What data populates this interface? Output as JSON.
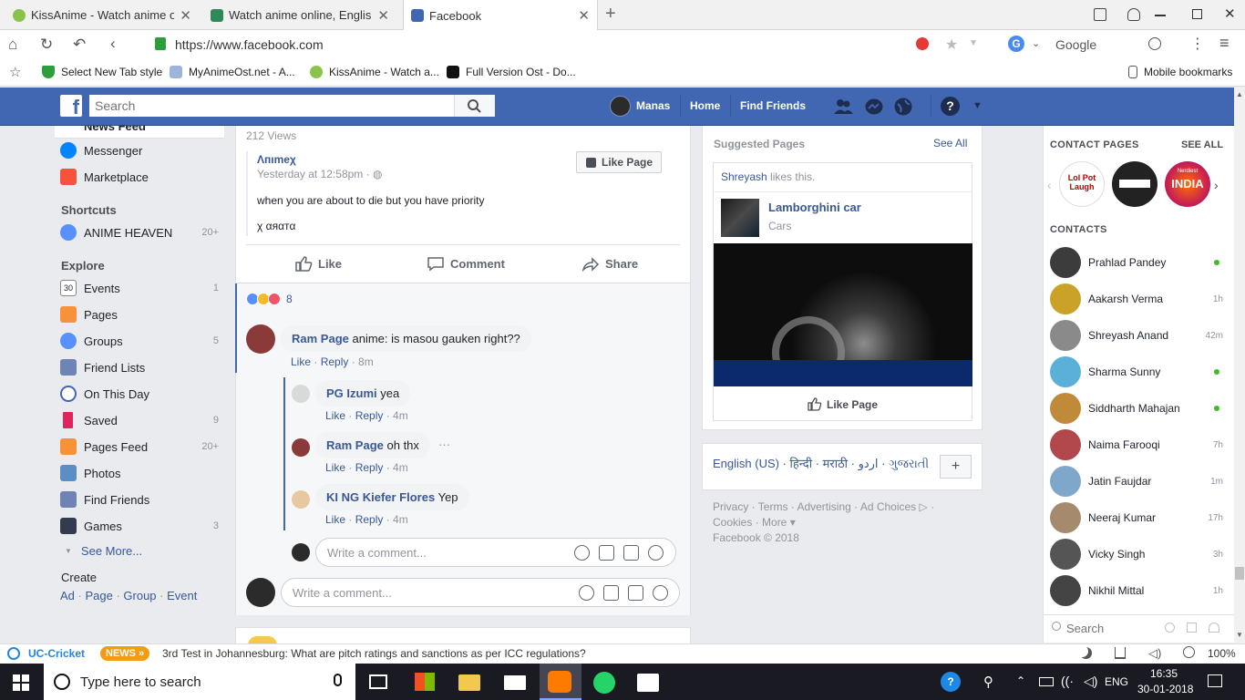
{
  "browser": {
    "tabs": [
      {
        "title": "KissAnime - Watch anime onli",
        "favicon_color": "#8bc34a"
      },
      {
        "title": "Watch anime online, English a",
        "favicon_color": "#2e8b57"
      },
      {
        "title": "Facebook",
        "favicon_color": "#4267b2"
      }
    ],
    "new_tab": "+",
    "url": "https://www.facebook.com",
    "search_engine": "Google",
    "bookmarks": [
      {
        "label": "Select New Tab style",
        "icon": "shield-icon"
      },
      {
        "label": "MyAnimeOst.net - A...",
        "icon": "myanime-icon"
      },
      {
        "label": "KissAnime - Watch a...",
        "icon": "kissanime-icon"
      },
      {
        "label": "Full Version Ost - Do...",
        "icon": "ost-icon"
      }
    ],
    "mobile_bookmarks": "Mobile bookmarks"
  },
  "fb_header": {
    "search_placeholder": "Search",
    "user": "Manas",
    "home": "Home",
    "find_friends": "Find Friends"
  },
  "left_nav": {
    "top_items": [
      {
        "label": "News Feed",
        "color": "#4267b2"
      },
      {
        "label": "Messenger",
        "color": "#0084ff"
      },
      {
        "label": "Marketplace",
        "color": "#f5533d"
      }
    ],
    "shortcuts_heading": "Shortcuts",
    "shortcuts": [
      {
        "label": "ANIME HEAVEN",
        "count": "20+",
        "color": "#5890ff"
      }
    ],
    "explore_heading": "Explore",
    "explore": [
      {
        "label": "Events",
        "count": "1",
        "color": "#e9ebee",
        "icon": "calendar-icon"
      },
      {
        "label": "Pages",
        "count": "",
        "color": "#f7923b",
        "icon": "flag-icon"
      },
      {
        "label": "Groups",
        "count": "5",
        "color": "#5890ff",
        "icon": "groups-icon"
      },
      {
        "label": "Friend Lists",
        "count": "",
        "color": "#6d84b4",
        "icon": "friendlist-icon"
      },
      {
        "label": "On This Day",
        "count": "",
        "color": "#4267b2",
        "icon": "clock-icon"
      },
      {
        "label": "Saved",
        "count": "9",
        "color": "#e0245e",
        "icon": "bookmark-icon"
      },
      {
        "label": "Pages Feed",
        "count": "20+",
        "color": "#f7923b",
        "icon": "pagesfeed-icon"
      },
      {
        "label": "Photos",
        "count": "",
        "color": "#5b8ec4",
        "icon": "photos-icon"
      },
      {
        "label": "Find Friends",
        "count": "",
        "color": "#6d84b4",
        "icon": "findfriends-icon"
      },
      {
        "label": "Games",
        "count": "3",
        "color": "#333c4e",
        "icon": "games-icon"
      }
    ],
    "see_more": "See More...",
    "create_heading": "Create",
    "create_links": [
      "Ad",
      "Page",
      "Group",
      "Event"
    ]
  },
  "post": {
    "views": "212 Views",
    "shared_author": "Λпımeχ",
    "shared_time": "Yesterday at 12:58pm",
    "like_page": "Like Page",
    "text1": "when you are about to die but you have priority",
    "text2": "χ αяαтα",
    "actions": {
      "like": "Like",
      "comment": "Comment",
      "share": "Share"
    },
    "reaction_count": "8",
    "comments": [
      {
        "name": "Ram Page",
        "text": "anime: is masou gauken right??",
        "like": "Like",
        "reply": "Reply",
        "time": "8m",
        "avatar_color": "#8b3a3a"
      },
      {
        "name": "PG Izumi",
        "text": "yea",
        "like": "Like",
        "reply": "Reply",
        "time": "4m",
        "avatar_color": "#d9d9d9"
      },
      {
        "name": "Ram Page",
        "text": "oh thx",
        "like": "Like",
        "reply": "Reply",
        "time": "4m",
        "avatar_color": "#8b3a3a"
      },
      {
        "name": "KI NG Kiefer Flores",
        "text": "Yep",
        "like": "Like",
        "reply": "Reply",
        "time": "4m",
        "avatar_color": "#e8c8a0"
      }
    ],
    "more_dots": "···",
    "reply_placeholder": "Write a comment...",
    "comment_placeholder": "Write a comment..."
  },
  "suggested": {
    "title": "Suggested Pages",
    "see_all": "See All",
    "friend_like_name": "Shreyash",
    "friend_like_text": "likes this.",
    "page_name": "Lamborghini car",
    "page_category": "Cars",
    "like_page": "Like Page"
  },
  "footer": {
    "languages": "English (US) · हिन्दी · मराठी · اردو · ગુજરાતી",
    "add_lang": "+",
    "links1": "Privacy · Terms · Advertising · Ad Choices ▷ ·",
    "links2": "Cookies · More ▾",
    "copyright": "Facebook © 2018"
  },
  "chat": {
    "contact_pages": "CONTACT PAGES",
    "see_all": "SEE ALL",
    "pages": [
      {
        "label": "Lol Pot Laugh",
        "color": "#ffffff"
      },
      {
        "label": "",
        "color": "#222222"
      },
      {
        "label": "INDIA",
        "color": "#c2185b"
      }
    ],
    "pages_caption_top": "Nerdiest",
    "contacts_heading": "CONTACTS",
    "contacts": [
      {
        "name": "Prahlad Pandey",
        "status": "online",
        "color": "#3c3c3c"
      },
      {
        "name": "Aakarsh Verma",
        "status": "1h",
        "color": "#c9a227"
      },
      {
        "name": "Shreyash Anand",
        "status": "42m",
        "color": "#8a8a8a"
      },
      {
        "name": "Sharma Sunny",
        "status": "online",
        "color": "#5ab0d8"
      },
      {
        "name": "Siddharth Mahajan",
        "status": "online",
        "color": "#c08a3a"
      },
      {
        "name": "Naima Farooqi",
        "status": "7h",
        "color": "#b2474c"
      },
      {
        "name": "Jatin Faujdar",
        "status": "1m",
        "color": "#7fa7c9"
      },
      {
        "name": "Neeraj Kumar",
        "status": "17h",
        "color": "#a68a6d"
      },
      {
        "name": "Vicky Singh",
        "status": "3h",
        "color": "#555555"
      },
      {
        "name": "Nikhil Mittal",
        "status": "1h",
        "color": "#444444"
      }
    ],
    "search_placeholder": "Search"
  },
  "news": {
    "source": "UC-Cricket",
    "badge": "NEWS",
    "headline": "3rd Test in Johannesburg: What are pitch ratings and sanctions as per ICC regulations?",
    "zoom": "100%"
  },
  "taskbar": {
    "search_placeholder": "Type here to search",
    "lang": "ENG",
    "time": "16:35",
    "date": "30-01-2018"
  },
  "colors": {
    "fb_blue": "#4267b2",
    "link": "#385898",
    "online": "#42b72a"
  }
}
